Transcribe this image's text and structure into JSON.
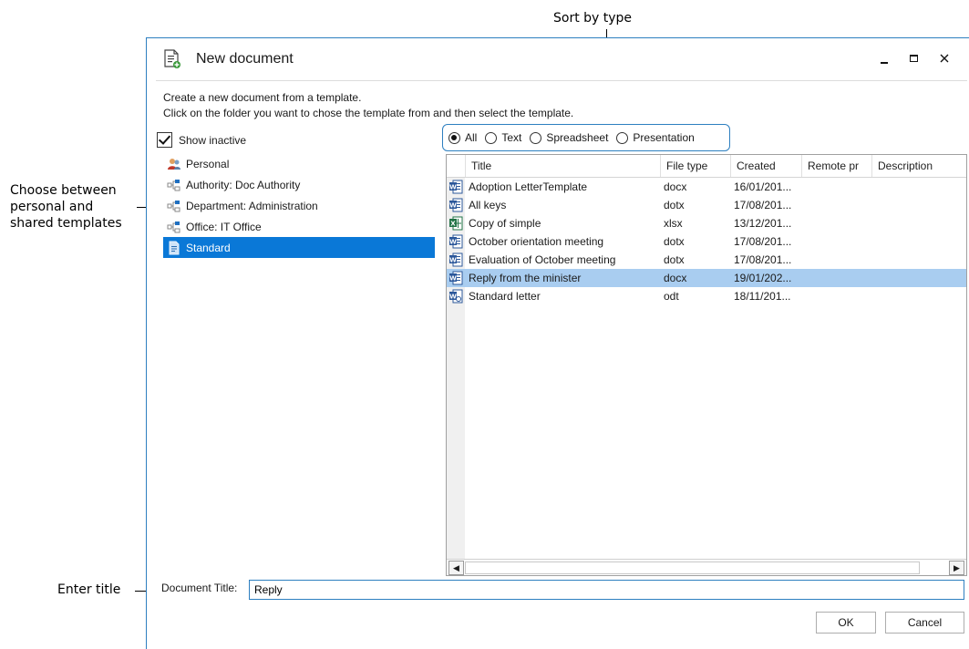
{
  "annotations": {
    "sort_by_type": "Sort by type",
    "choose_line1": "Choose between",
    "choose_line2": "personal and",
    "choose_line3": "shared templates",
    "enter_title": "Enter title"
  },
  "window": {
    "title": "New document",
    "instruction_line1": "Create a new document from a template.",
    "instruction_line2": "Click on the folder you want to chose the template from and then select the template."
  },
  "show_inactive": {
    "label": "Show inactive",
    "checked": true
  },
  "tree": [
    {
      "label": "Personal",
      "icon": "personal-icon"
    },
    {
      "label": "Authority: Doc Authority",
      "icon": "org-unit-icon"
    },
    {
      "label": "Department: Administration",
      "icon": "org-unit-icon"
    },
    {
      "label": "Office: IT Office",
      "icon": "org-unit-icon"
    },
    {
      "label": "Standard",
      "icon": "template-folder-icon",
      "selected": true
    }
  ],
  "filter": {
    "options": [
      "All",
      "Text",
      "Spreadsheet",
      "Presentation"
    ],
    "selected": "All"
  },
  "table": {
    "columns": [
      "Title",
      "File type",
      "Created",
      "Remote pr",
      "Description"
    ],
    "rows": [
      {
        "icon": "word-template-icon",
        "title": "Adoption LetterTemplate",
        "type": "docx",
        "created": "16/01/201...",
        "remote": "",
        "description": ""
      },
      {
        "icon": "word-template-icon",
        "title": "All keys",
        "type": "dotx",
        "created": "17/08/201...",
        "remote": "",
        "description": ""
      },
      {
        "icon": "excel-template-icon",
        "title": "Copy of simple",
        "type": "xlsx",
        "created": "13/12/201...",
        "remote": "",
        "description": ""
      },
      {
        "icon": "word-template-icon",
        "title": "October orientation meeting",
        "type": "dotx",
        "created": "17/08/201...",
        "remote": "",
        "description": ""
      },
      {
        "icon": "word-template-icon",
        "title": "Evaluation of October meeting",
        "type": "dotx",
        "created": "17/08/201...",
        "remote": "",
        "description": ""
      },
      {
        "icon": "word-template-icon",
        "title": "Reply from the minister",
        "type": "docx",
        "created": "19/01/202...",
        "remote": "",
        "description": "",
        "selected": true
      },
      {
        "icon": "odt-template-icon",
        "title": "Standard letter",
        "type": "odt",
        "created": "18/11/201...",
        "remote": "",
        "description": ""
      }
    ]
  },
  "document_title": {
    "label": "Document Title:",
    "value": "Reply"
  },
  "buttons": {
    "ok": "OK",
    "cancel": "Cancel"
  },
  "colors": {
    "accent": "#2d7fc0",
    "selection": "#0a78d7",
    "row_selection": "#a9cdf0"
  }
}
